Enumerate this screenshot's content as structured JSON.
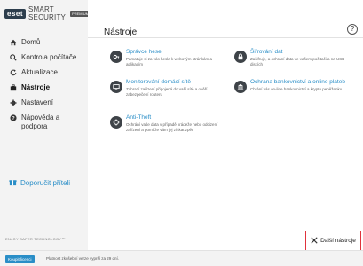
{
  "app": {
    "brand": "eset",
    "product": "SMART SECURITY",
    "edition": "PREMIUM",
    "footer": "ENJOY SAFER TECHNOLOGY™"
  },
  "sidebar": {
    "items": [
      {
        "label": "Domů",
        "icon": "home-icon"
      },
      {
        "label": "Kontrola počítače",
        "icon": "search-icon"
      },
      {
        "label": "Aktualizace",
        "icon": "refresh-icon"
      },
      {
        "label": "Nástroje",
        "icon": "briefcase-icon",
        "active": true
      },
      {
        "label": "Nastavení",
        "icon": "gear-icon"
      },
      {
        "label": "Nápověda a podpora",
        "icon": "help-icon"
      }
    ],
    "recommend": "Doporučit příteli"
  },
  "main": {
    "title": "Nástroje",
    "tools": [
      {
        "title": "Správce hesel",
        "desc": "Pamatuje si za vás hesla k webovým stránkám a aplikacím",
        "icon": "password-manager-icon"
      },
      {
        "title": "Šifrování dat",
        "desc": "Zašifruje, a ochrání data ve vašem počítači a na USB discích",
        "icon": "lock-icon"
      },
      {
        "title": "Monitorování domácí sítě",
        "desc": "Zobrazí zařízení připojená do vaší sítě a ověří zabezpečení routeru",
        "icon": "network-icon"
      },
      {
        "title": "Ochrana bankovnictví a online plateb",
        "desc": "Chrání vás on-line bankovnictví a krypto peněženku",
        "icon": "bank-icon"
      },
      {
        "title": "Anti-Theft",
        "desc": "Ochrání vaše data v případě krádeže nebo odcizení zařízení a pomůže vám jej získat zpět",
        "icon": "anti-theft-icon"
      }
    ],
    "more_tools": "Další nástroje"
  },
  "statusbar": {
    "buy": "Koupit licenci",
    "license": "Platnost zkušební verze vyprší za 29 dní."
  },
  "colors": {
    "accent": "#2a8ec7",
    "highlight": "#e0323c",
    "icon_bg": "#3e4348"
  }
}
